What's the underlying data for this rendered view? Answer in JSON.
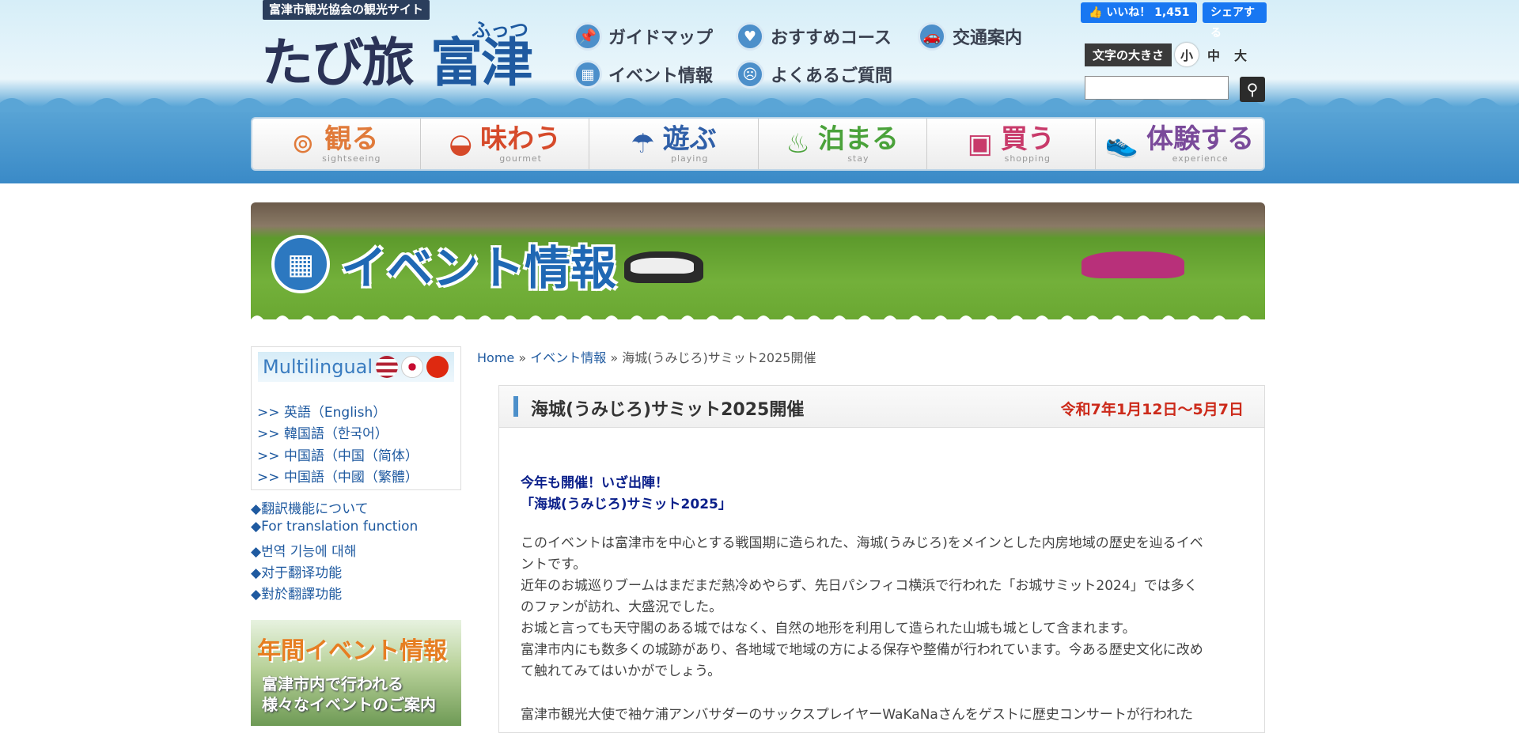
{
  "header": {
    "site_badge": "富津市観光協会の観光サイト",
    "logo_main": "たび旅",
    "logo_futtsu": "富津",
    "logo_ruby": "ふっつ"
  },
  "topnav": [
    {
      "label": "ガイドマップ",
      "icon": "pushpin-icon"
    },
    {
      "label": "おすすめコース",
      "icon": "heart-icon"
    },
    {
      "label": "交通案内",
      "icon": "car-icon"
    },
    {
      "label": "イベント情報",
      "icon": "calendar-icon"
    },
    {
      "label": "よくあるご質問",
      "icon": "question-face-icon"
    }
  ],
  "social": {
    "like_label": "いいね！ 1,451",
    "share_label": "シェアする"
  },
  "font_size": {
    "label": "文字の大きさ",
    "small": "小",
    "medium": "中",
    "large": "大"
  },
  "categories": [
    {
      "jp": "観る",
      "en": "sightseeing",
      "color": "#e07a3a",
      "icon": "binoculars-icon"
    },
    {
      "jp": "味わう",
      "en": "gourmet",
      "color": "#d64a2a",
      "icon": "rice-bowl-icon"
    },
    {
      "jp": "遊ぶ",
      "en": "playing",
      "color": "#2f5fa8",
      "icon": "parasol-icon"
    },
    {
      "jp": "泊まる",
      "en": "stay",
      "color": "#4aa23a",
      "icon": "hot-spring-icon"
    },
    {
      "jp": "買う",
      "en": "shopping",
      "color": "#c83a6a",
      "icon": "gift-icon"
    },
    {
      "jp": "体験する",
      "en": "experience",
      "color": "#7a4a9a",
      "icon": "shoe-icon"
    }
  ],
  "hero": {
    "title": "イベント情報"
  },
  "sidebar": {
    "multilingual": "Multilingual",
    "languages": [
      ">> 英語（English）",
      ">> 韓国語（한국어）",
      ">> 中国語（中国（简体）",
      ">> 中国語（中國（繁體）"
    ],
    "translation_links": [
      "◆翻訳機能について",
      "◆For translation function",
      "◆번역 기능에 대해",
      "◆对于翻译功能",
      "◆對於翻譯功能"
    ],
    "banner_title": "年間イベント情報",
    "banner_sub_1": "富津市内で行われる",
    "banner_sub_2": "様々なイベントのご案内"
  },
  "breadcrumb": {
    "home": "Home",
    "sep": "»",
    "section": "イベント情報",
    "current": "海城(うみじろ)サミット2025開催"
  },
  "article": {
    "title": "海城(うみじろ)サミット2025開催",
    "date": "令和7年1月12日〜5月7日",
    "lead_1": "今年も開催！いざ出陣！",
    "lead_2": "「海城(うみじろ)サミット2025」",
    "paras": [
      "このイベントは富津市を中心とする戦国期に造られた、海城(うみじろ)をメインとした内房地域の歴史を辿るイベ",
      "ントです。",
      "近年のお城巡りブームはまだまだ熱冷めやらず、先日パシフィコ横浜で行われた「お城サミット2024」では多く",
      "のファンが訪れ、大盛況でした。",
      "お城と言っても天守閣のある城ではなく、自然の地形を利用して造られた山城も城として含まれます。",
      "富津市内にも数多くの城跡があり、各地域で地域の方による保存や整備が行われています。今ある歴史文化に改め",
      "て触れてみてはいかがでしょう。",
      "富津市観光大使で袖ケ浦アンバサダーのサックスプレイヤーWaKaNaさんをゲストに歴史コンサートが行われた"
    ]
  }
}
